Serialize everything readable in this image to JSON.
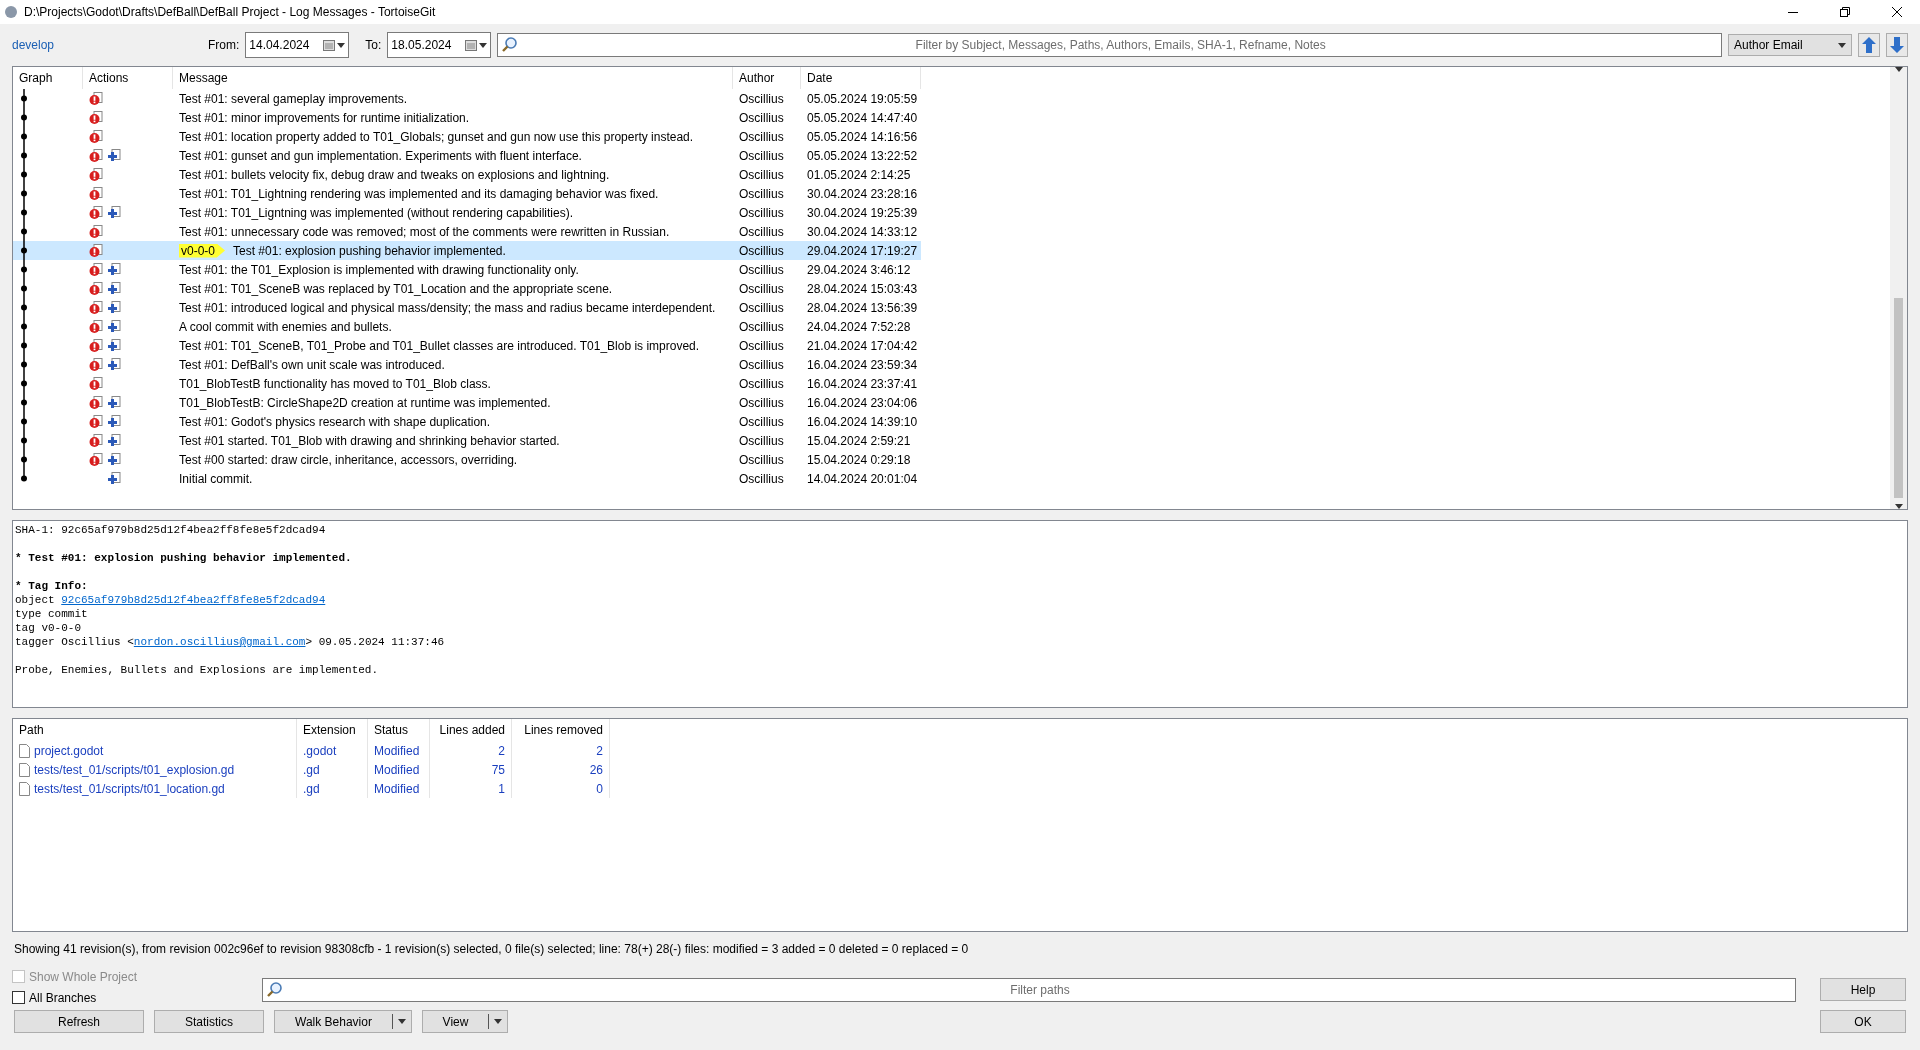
{
  "window": {
    "title": "D:\\Projects\\Godot\\Drafts\\DefBall\\DefBall Project - Log Messages - TortoiseGit"
  },
  "toolbar": {
    "branch": "develop",
    "from_label": "From:",
    "from_date": "14.04.2024",
    "to_label": "To:",
    "to_date": "18.05.2024",
    "filter": {
      "placeholder": "Filter by Subject, Messages, Paths, Authors, Emails, SHA-1, Refname, Notes"
    },
    "filter_field": "Author Email"
  },
  "log": {
    "columns": [
      "Graph",
      "Actions",
      "Message",
      "Author",
      "Date"
    ],
    "rows": [
      {
        "modified": true,
        "added": false,
        "message": "Test #01: several gameplay improvements.",
        "author": "Oscillius",
        "date": "05.05.2024 19:05:59",
        "selected": false
      },
      {
        "modified": true,
        "added": false,
        "message": "Test #01: minor improvements for runtime initialization.",
        "author": "Oscillius",
        "date": "05.05.2024 14:47:40",
        "selected": false
      },
      {
        "modified": true,
        "added": false,
        "message": "Test #01: location property added to T01_Globals; gunset and gun now use this property instead.",
        "author": "Oscillius",
        "date": "05.05.2024 14:16:56",
        "selected": false
      },
      {
        "modified": true,
        "added": true,
        "message": "Test #01: gunset and gun implementation. Experiments with fluent interface.",
        "author": "Oscillius",
        "date": "05.05.2024 13:22:52",
        "selected": false
      },
      {
        "modified": true,
        "added": false,
        "message": "Test #01: bullets velocity fix, debug draw and tweaks on explosions and lightning.",
        "author": "Oscillius",
        "date": "01.05.2024 2:14:25",
        "selected": false
      },
      {
        "modified": true,
        "added": false,
        "message": "Test #01: T01_Lightning rendering was implemented and its damaging behavior was fixed.",
        "author": "Oscillius",
        "date": "30.04.2024 23:28:16",
        "selected": false
      },
      {
        "modified": true,
        "added": true,
        "message": "Test #01: T01_Ligntning was implemented (without rendering capabilities).",
        "author": "Oscillius",
        "date": "30.04.2024 19:25:39",
        "selected": false
      },
      {
        "modified": true,
        "added": false,
        "message": "Test #01: unnecessary code was removed; most of the comments were rewritten in Russian.",
        "author": "Oscillius",
        "date": "30.04.2024 14:33:12",
        "selected": false
      },
      {
        "modified": true,
        "added": false,
        "tag": "v0-0-0",
        "message": "Test #01: explosion pushing behavior implemented.",
        "author": "Oscillius",
        "date": "29.04.2024 17:19:27",
        "selected": true
      },
      {
        "modified": true,
        "added": true,
        "message": "Test #01: the T01_Explosion is implemented with drawing functionality only.",
        "author": "Oscillius",
        "date": "29.04.2024 3:46:12",
        "selected": false
      },
      {
        "modified": true,
        "added": true,
        "message": "Test #01: T01_SceneB was replaced by T01_Location and the appropriate scene.",
        "author": "Oscillius",
        "date": "28.04.2024 15:03:43",
        "selected": false
      },
      {
        "modified": true,
        "added": true,
        "message": "Test #01: introduced logical and physical mass/density; the mass and radius became interdependent.",
        "author": "Oscillius",
        "date": "28.04.2024 13:56:39",
        "selected": false
      },
      {
        "modified": true,
        "added": true,
        "message": "A cool commit with enemies and bullets.",
        "author": "Oscillius",
        "date": "24.04.2024 7:52:28",
        "selected": false
      },
      {
        "modified": true,
        "added": true,
        "message": "Test #01: T01_SceneB, T01_Probe and T01_Bullet classes are introduced. T01_Blob is improved.",
        "author": "Oscillius",
        "date": "21.04.2024 17:04:42",
        "selected": false
      },
      {
        "modified": true,
        "added": true,
        "message": "Test #01: DefBall's own unit scale was introduced.",
        "author": "Oscillius",
        "date": "16.04.2024 23:59:34",
        "selected": false
      },
      {
        "modified": true,
        "added": false,
        "message": "T01_BlobTestB functionality has moved to T01_Blob class.",
        "author": "Oscillius",
        "date": "16.04.2024 23:37:41",
        "selected": false
      },
      {
        "modified": true,
        "added": true,
        "message": "T01_BlobTestB: CircleShape2D creation at runtime was implemented.",
        "author": "Oscillius",
        "date": "16.04.2024 23:04:06",
        "selected": false
      },
      {
        "modified": true,
        "added": true,
        "message": "Test #01: Godot's physics research with shape duplication.",
        "author": "Oscillius",
        "date": "16.04.2024 14:39:10",
        "selected": false
      },
      {
        "modified": true,
        "added": true,
        "message": "Test #01 started. T01_Blob with drawing and shrinking behavior started.",
        "author": "Oscillius",
        "date": "15.04.2024 2:59:21",
        "selected": false
      },
      {
        "modified": true,
        "added": true,
        "message": "Test #00 started: draw circle, inheritance, accessors, overriding.",
        "author": "Oscillius",
        "date": "15.04.2024 0:29:18",
        "selected": false
      },
      {
        "modified": false,
        "added": true,
        "message": "Initial commit.",
        "author": "Oscillius",
        "date": "14.04.2024 20:01:04",
        "selected": false
      }
    ]
  },
  "details": {
    "blocks": [
      [
        [
          {
            "kind": "text",
            "text": "SHA-1: 92c65af979b8d25d12f4bea2ff8fe8e5f2dcad94"
          }
        ]
      ],
      [
        [
          {
            "kind": "bold",
            "text": "* Test #01: explosion pushing behavior implemented."
          }
        ]
      ],
      [
        [
          {
            "kind": "bold",
            "text": "* Tag Info:"
          }
        ],
        [
          {
            "kind": "text",
            "text": "object "
          },
          {
            "kind": "link",
            "text": "92c65af979b8d25d12f4bea2ff8fe8e5f2dcad94"
          }
        ],
        [
          {
            "kind": "text",
            "text": "type commit"
          }
        ],
        [
          {
            "kind": "text",
            "text": "tag v0-0-0"
          }
        ],
        [
          {
            "kind": "text",
            "text": "tagger Oscillius <"
          },
          {
            "kind": "link",
            "text": "nordon.oscillius@gmail.com"
          },
          {
            "kind": "text",
            "text": "> 09.05.2024 11:37:46"
          }
        ]
      ],
      [
        [
          {
            "kind": "text",
            "text": "Probe, Enemies, Bullets and Explosions are implemented."
          }
        ]
      ]
    ]
  },
  "files": {
    "columns": [
      "Path",
      "Extension",
      "Status",
      "Lines added",
      "Lines removed"
    ],
    "rows": [
      {
        "path": "project.godot",
        "extension": ".godot",
        "status": "Modified",
        "added": "2",
        "removed": "2"
      },
      {
        "path": "tests/test_01/scripts/t01_explosion.gd",
        "extension": ".gd",
        "status": "Modified",
        "added": "75",
        "removed": "26"
      },
      {
        "path": "tests/test_01/scripts/t01_location.gd",
        "extension": ".gd",
        "status": "Modified",
        "added": "1",
        "removed": "0"
      }
    ]
  },
  "status_bar": "Showing 41 revision(s), from revision 002c96ef to revision 98308cfb - 1 revision(s) selected, 0 file(s) selected; line: 78(+) 28(-) files: modified = 3 added = 0 deleted = 0 replaced = 0",
  "options": [
    {
      "label": "Show Whole Project",
      "checked": false,
      "disabled": true
    },
    {
      "label": "All Branches",
      "checked": false,
      "disabled": false
    }
  ],
  "path_filter": {
    "placeholder": "Filter paths"
  },
  "buttons": [
    {
      "label": "Refresh",
      "kind": "plain"
    },
    {
      "label": "Statistics",
      "kind": "plain"
    },
    {
      "label": "Walk Behavior",
      "kind": "split"
    },
    {
      "label": "View",
      "kind": "split"
    }
  ],
  "side_buttons": [
    "Help",
    "OK"
  ]
}
